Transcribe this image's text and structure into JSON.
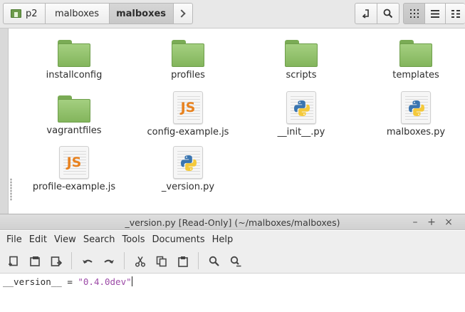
{
  "file_manager": {
    "breadcrumb": {
      "items": [
        "p2",
        "malboxes",
        "malboxes"
      ],
      "active_index": 2
    },
    "toolbar_icons": [
      "terminal-icon",
      "search-icon",
      "grid-view-icon",
      "list-view-icon",
      "compact-view-icon"
    ],
    "files": [
      {
        "name": "installconfig",
        "type": "folder"
      },
      {
        "name": "profiles",
        "type": "folder"
      },
      {
        "name": "scripts",
        "type": "folder"
      },
      {
        "name": "templates",
        "type": "folder"
      },
      {
        "name": "vagrantfiles",
        "type": "folder"
      },
      {
        "name": "config-example.js",
        "type": "javascript"
      },
      {
        "name": "__init__.py",
        "type": "python"
      },
      {
        "name": "malboxes.py",
        "type": "python"
      },
      {
        "name": "profile-example.js",
        "type": "javascript"
      },
      {
        "name": "_version.py",
        "type": "python"
      }
    ]
  },
  "editor": {
    "title": "_version.py [Read-Only] (~/malboxes/malboxes)",
    "menu": [
      "File",
      "Edit",
      "View",
      "Search",
      "Tools",
      "Documents",
      "Help"
    ],
    "window_controls": [
      "–",
      "+",
      "×"
    ],
    "code": {
      "identifier": "__version__",
      "operator": " = ",
      "string": "\"0.4.0dev\""
    }
  },
  "colors": {
    "folder_green": "#83b55c",
    "js_orange": "#e8821f",
    "string_purple": "#9c4aa7",
    "toolbar_gray": "#e8e8e8"
  }
}
